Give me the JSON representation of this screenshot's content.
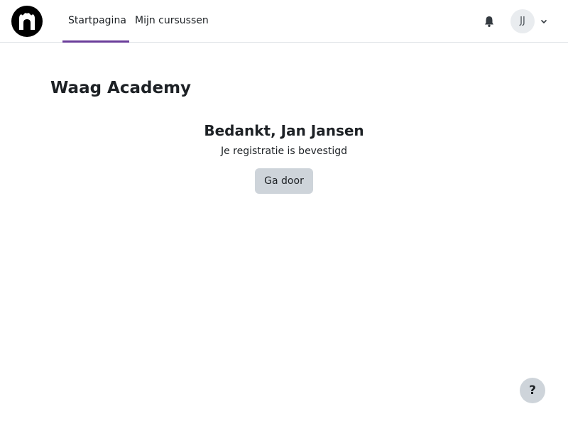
{
  "navbar": {
    "logo_icon": "waag-logo-icon",
    "items": [
      {
        "label": "Startpagina",
        "active": true
      },
      {
        "label": "Mijn cursussen",
        "active": false
      }
    ],
    "notifications_icon": "bell-icon",
    "user": {
      "initials": "JJ",
      "menu_icon": "chevron-down-icon"
    }
  },
  "page": {
    "title": "Waag Academy"
  },
  "confirmation": {
    "heading": "Bedankt, Jan Jansen",
    "message": "Je registratie is bevestigd",
    "button_label": "Ga door"
  },
  "help": {
    "label": "?"
  },
  "colors": {
    "accent": "#6a3d9a",
    "button_bg": "#ced4da",
    "avatar_bg": "#e9ecef",
    "text": "#1d2125"
  }
}
